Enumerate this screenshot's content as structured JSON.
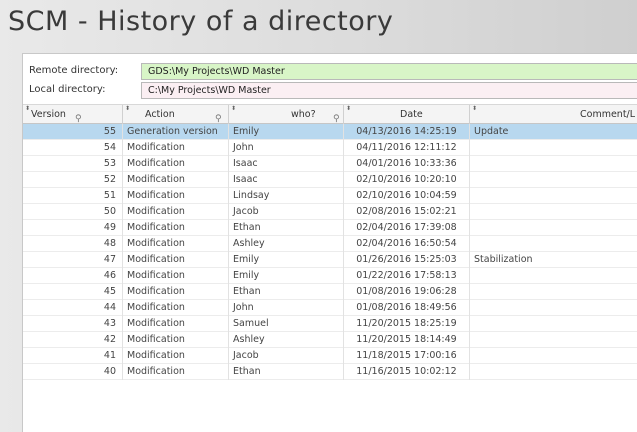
{
  "title": "SCM - History of a directory",
  "remote": {
    "label": "Remote directory:",
    "value": "GDS:\\My Projects\\WD Master"
  },
  "local": {
    "label": "Local directory:",
    "value": "C:\\My Projects\\WD Master"
  },
  "columns": {
    "version": "Version",
    "action": "Action",
    "who": "who?",
    "date": "Date",
    "comment": "Comment/L"
  },
  "rows": [
    {
      "version": "55",
      "action": "Generation version",
      "who": "Emily",
      "date": "04/13/2016 14:25:19",
      "comment": "Update",
      "selected": true
    },
    {
      "version": "54",
      "action": "Modification",
      "who": "John",
      "date": "04/11/2016 12:11:12",
      "comment": ""
    },
    {
      "version": "53",
      "action": "Modification",
      "who": "Isaac",
      "date": "04/01/2016 10:33:36",
      "comment": ""
    },
    {
      "version": "52",
      "action": "Modification",
      "who": "Isaac",
      "date": "02/10/2016 10:20:10",
      "comment": ""
    },
    {
      "version": "51",
      "action": "Modification",
      "who": "Lindsay",
      "date": "02/10/2016 10:04:59",
      "comment": ""
    },
    {
      "version": "50",
      "action": "Modification",
      "who": "Jacob",
      "date": "02/08/2016 15:02:21",
      "comment": ""
    },
    {
      "version": "49",
      "action": "Modification",
      "who": "Ethan",
      "date": "02/04/2016 17:39:08",
      "comment": ""
    },
    {
      "version": "48",
      "action": "Modification",
      "who": "Ashley",
      "date": "02/04/2016 16:50:54",
      "comment": ""
    },
    {
      "version": "47",
      "action": "Modification",
      "who": "Emily",
      "date": "01/26/2016 15:25:03",
      "comment": "Stabilization"
    },
    {
      "version": "46",
      "action": "Modification",
      "who": "Emily",
      "date": "01/22/2016 17:58:13",
      "comment": ""
    },
    {
      "version": "45",
      "action": "Modification",
      "who": "Ethan",
      "date": "01/08/2016 19:06:28",
      "comment": ""
    },
    {
      "version": "44",
      "action": "Modification",
      "who": "John",
      "date": "01/08/2016 18:49:56",
      "comment": ""
    },
    {
      "version": "43",
      "action": "Modification",
      "who": "Samuel",
      "date": "11/20/2015 18:25:19",
      "comment": ""
    },
    {
      "version": "42",
      "action": "Modification",
      "who": "Ashley",
      "date": "11/20/2015 18:14:49",
      "comment": ""
    },
    {
      "version": "41",
      "action": "Modification",
      "who": "Jacob",
      "date": "11/18/2015 17:00:16",
      "comment": ""
    },
    {
      "version": "40",
      "action": "Modification",
      "who": "Ethan",
      "date": "11/16/2015 10:02:12",
      "comment": ""
    }
  ]
}
